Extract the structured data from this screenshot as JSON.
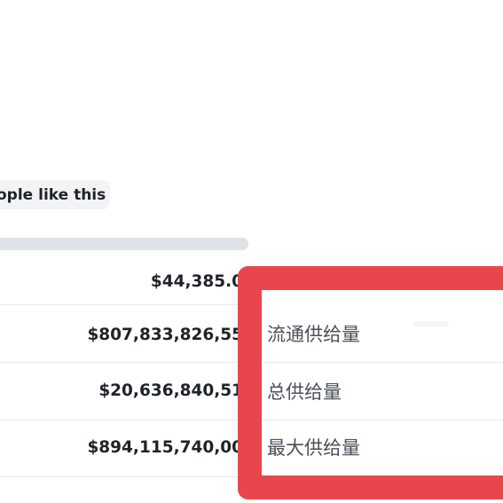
{
  "reaction": {
    "label": "ople like this"
  },
  "supply_progress": {
    "fill_fraction": 0.0
  },
  "rows": [
    {
      "value": "$44,385.0"
    },
    {
      "value": "$807,833,826,55"
    },
    {
      "value": "$20,636,840,51"
    },
    {
      "value": "$894,115,740,00"
    }
  ],
  "highlight": {
    "color": "#e8464d",
    "labels": [
      "流通供给量",
      "总供给量",
      "最大供给量"
    ]
  }
}
